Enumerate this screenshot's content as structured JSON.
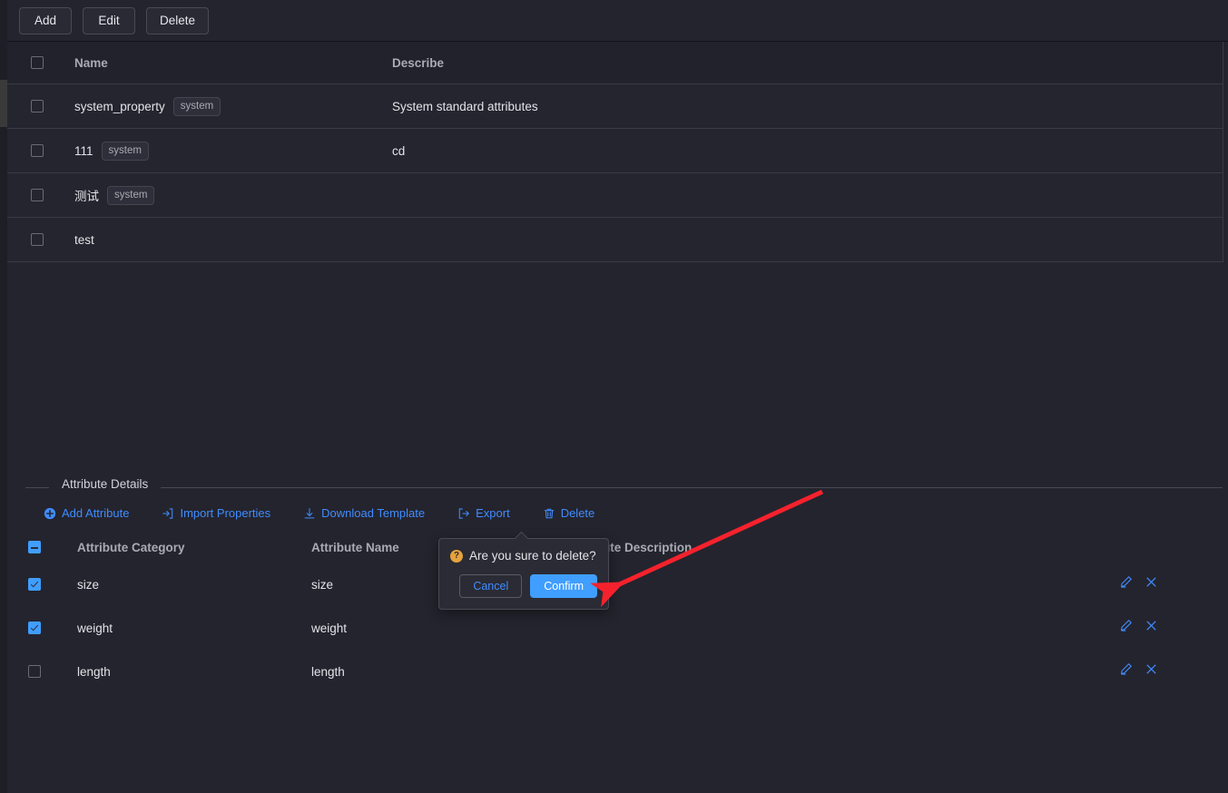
{
  "toolbar": {
    "buttons": [
      {
        "label": "Add",
        "name": "add-button"
      },
      {
        "label": "Edit",
        "name": "edit-button"
      },
      {
        "label": "Delete",
        "name": "delete-button"
      }
    ]
  },
  "main_table": {
    "columns": [
      "Name",
      "Describe"
    ],
    "rows": [
      {
        "name": "system_property",
        "tag": "system",
        "describe": "System standard attributes",
        "checked": false
      },
      {
        "name": "111",
        "tag": "system",
        "describe": "cd",
        "checked": false
      },
      {
        "name": "测试",
        "tag": "system",
        "describe": "",
        "checked": false
      },
      {
        "name": "test",
        "tag": "",
        "describe": "",
        "checked": false
      }
    ]
  },
  "attribute_details": {
    "legend": "Attribute Details",
    "links": [
      {
        "label": "Add Attribute",
        "icon": "plus-circle-icon",
        "name": "add-attribute-link"
      },
      {
        "label": "Import Properties",
        "icon": "import-icon",
        "name": "import-properties-link"
      },
      {
        "label": "Download Template",
        "icon": "download-icon",
        "name": "download-template-link"
      },
      {
        "label": "Export",
        "icon": "export-icon",
        "name": "export-link"
      },
      {
        "label": "Delete",
        "icon": "trash-icon",
        "name": "delete-link"
      }
    ],
    "columns": [
      "Attribute Category",
      "Attribute Name",
      "Attribute Description"
    ],
    "header_checkbox_state": "indeterminate",
    "rows": [
      {
        "category": "size",
        "attr_name": "size",
        "description": "",
        "checked": true
      },
      {
        "category": "weight",
        "attr_name": "weight",
        "description": "",
        "checked": true
      },
      {
        "category": "length",
        "attr_name": "length",
        "description": "",
        "checked": false
      }
    ],
    "row_actions": {
      "edit": "edit-pencil-icon",
      "delete": "close-x-icon"
    }
  },
  "popconfirm": {
    "message": "Are you sure to delete?",
    "cancel_label": "Cancel",
    "confirm_label": "Confirm"
  },
  "colors": {
    "background": "#24242e",
    "row_background": "#25252f",
    "header_background": "#22222c",
    "border": "#3a3a46",
    "accent": "#409eff",
    "link": "#3f8cff",
    "text": "#e3e3e8",
    "muted_text": "#a8abb2",
    "warning": "#e6a23c",
    "annotation_arrow": "#f5222d"
  }
}
